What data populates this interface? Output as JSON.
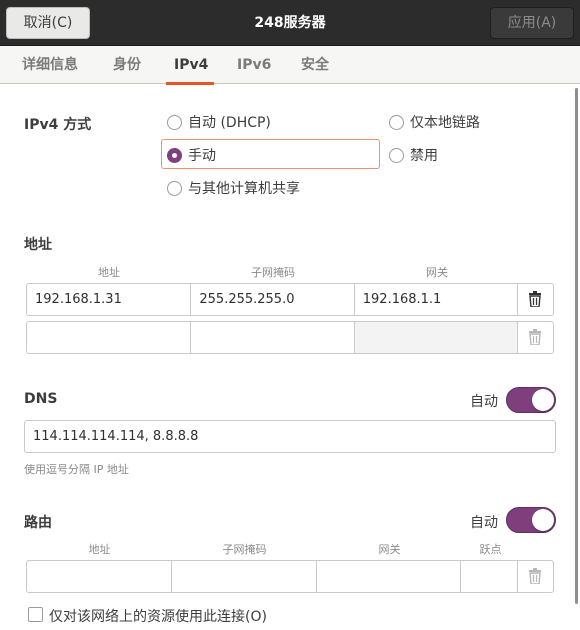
{
  "header": {
    "cancel_label": "取消(C)",
    "title": "248服务器",
    "apply_label": "应用(A)"
  },
  "tabs": [
    {
      "label": "详细信息"
    },
    {
      "label": "身份"
    },
    {
      "label": "IPv4",
      "active": true
    },
    {
      "label": "IPv6"
    },
    {
      "label": "安全"
    }
  ],
  "ipv4_method": {
    "label": "IPv4 方式",
    "options": {
      "auto_dhcp": "自动 (DHCP)",
      "link_local": "仅本地链路",
      "manual": "手动",
      "disabled": "禁用",
      "shared": "与其他计算机共享"
    },
    "selected": "手动"
  },
  "addresses": {
    "section_title": "地址",
    "columns": [
      "地址",
      "子网掩码",
      "网关"
    ],
    "rows": [
      {
        "address": "192.168.1.31",
        "netmask": "255.255.255.0",
        "gateway": "192.168.1.1"
      },
      {
        "address": "",
        "netmask": "",
        "gateway": ""
      }
    ]
  },
  "dns": {
    "section_title": "DNS",
    "auto_label": "自动",
    "auto_on": true,
    "value": "114.114.114.114, 8.8.8.8",
    "hint": "使用逗号分隔 IP 地址"
  },
  "routes": {
    "section_title": "路由",
    "auto_label": "自动",
    "auto_on": true,
    "columns": [
      "地址",
      "子网掩码",
      "网关",
      "跃点"
    ]
  },
  "only_local_resources": {
    "label": "仅对该网络上的资源使用此连接(O)",
    "checked": false
  },
  "colors": {
    "accent_orange": "#e95420",
    "switch_purple": "#7e3f7c",
    "header_dark": "#2c2c2c"
  }
}
